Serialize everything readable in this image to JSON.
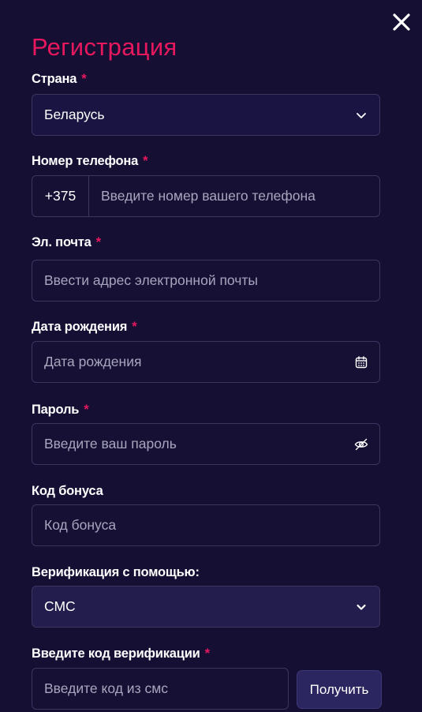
{
  "colors": {
    "background": "#140f33",
    "accent": "#e8185e",
    "required_mark": "#e8185e",
    "field_border": "#3b3560",
    "placeholder": "#a8a5be"
  },
  "header": {
    "title": "Регистрация",
    "close_icon": "close-icon"
  },
  "form": {
    "required_mark": "*",
    "country": {
      "label": "Страна",
      "value": "Беларусь",
      "icon": "chevron-down-icon"
    },
    "phone": {
      "label": "Номер телефона",
      "prefix": "+375",
      "placeholder": "Введите номер вашего телефона"
    },
    "email": {
      "label": "Эл. почта",
      "placeholder": "Ввести адрес электронной почты"
    },
    "birthdate": {
      "label": "Дата рождения",
      "placeholder": "Дата рождения",
      "icon": "calendar-icon"
    },
    "password": {
      "label": "Пароль",
      "placeholder": "Введите ваш пароль",
      "icon": "eye-off-icon"
    },
    "bonus_code": {
      "label": "Код бонуса",
      "placeholder": "Код бонуса"
    },
    "verification_method": {
      "label": "Верификация с помощью:",
      "value": "СМС",
      "icon": "chevron-down-icon"
    },
    "verification_code": {
      "label": "Введите код верификации",
      "placeholder": "Введите код из смс",
      "button_label": "Получить"
    }
  }
}
